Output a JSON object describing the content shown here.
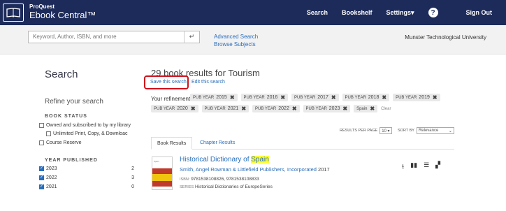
{
  "header": {
    "brand_top": "ProQuest",
    "brand_main": "Ebook Central™",
    "nav": [
      "Search",
      "Bookshelf",
      "Settings▾",
      "Sign Out"
    ]
  },
  "searchband": {
    "placeholder": "Keyword, Author, ISBN, and more",
    "advanced": "Advanced Search",
    "browse": "Browse Subjects",
    "university": "Munster Technological University"
  },
  "left": {
    "heading": "Search",
    "refine": "Refine your search",
    "book_status_title": "BOOK STATUS",
    "owned": "Owned and subscribed to by my library",
    "unlimited": "Unlimited Print, Copy, & Downloac",
    "course_reserve": "Course Reserve",
    "year_title": "YEAR PUBLISHED",
    "years": [
      {
        "label": "2023",
        "count": "2"
      },
      {
        "label": "2022",
        "count": "3"
      },
      {
        "label": "2021",
        "count": "0"
      }
    ]
  },
  "main": {
    "results_count": "29",
    "results_text": "book results for Tourism",
    "save_search": "Save this search",
    "edit_search": "Edit this search",
    "refinements_label": "Your refinements:",
    "chip_prefix": "PUB YEAR",
    "chips_row1": [
      "2015",
      "2016",
      "2017",
      "2018",
      "2019"
    ],
    "chips_row2": [
      "2020",
      "2021",
      "2022",
      "2023"
    ],
    "spain_chip": "Spain",
    "clear": "Clear",
    "results_per_page_label": "RESULTS PER PAGE",
    "results_per_page": "10 ▾",
    "sort_by_label": "SORT BY",
    "sort_by": "Relevance",
    "tab_books": "Book Results",
    "tab_chapters": "Chapter Results",
    "book": {
      "title_prefix": "Historical Dictionary of ",
      "title_highlight": "Spain",
      "authors": "Smith, Angel  Rowman & Littlefield Publishers, Incorporated",
      "year": "2017",
      "isbn_label": "ISBN:",
      "isbn": "9781538108826, 9781538108833",
      "series_label": "SERIES",
      "series": "Historical Dictionaries of EuropeSeries",
      "cover_text": "Spain"
    }
  }
}
